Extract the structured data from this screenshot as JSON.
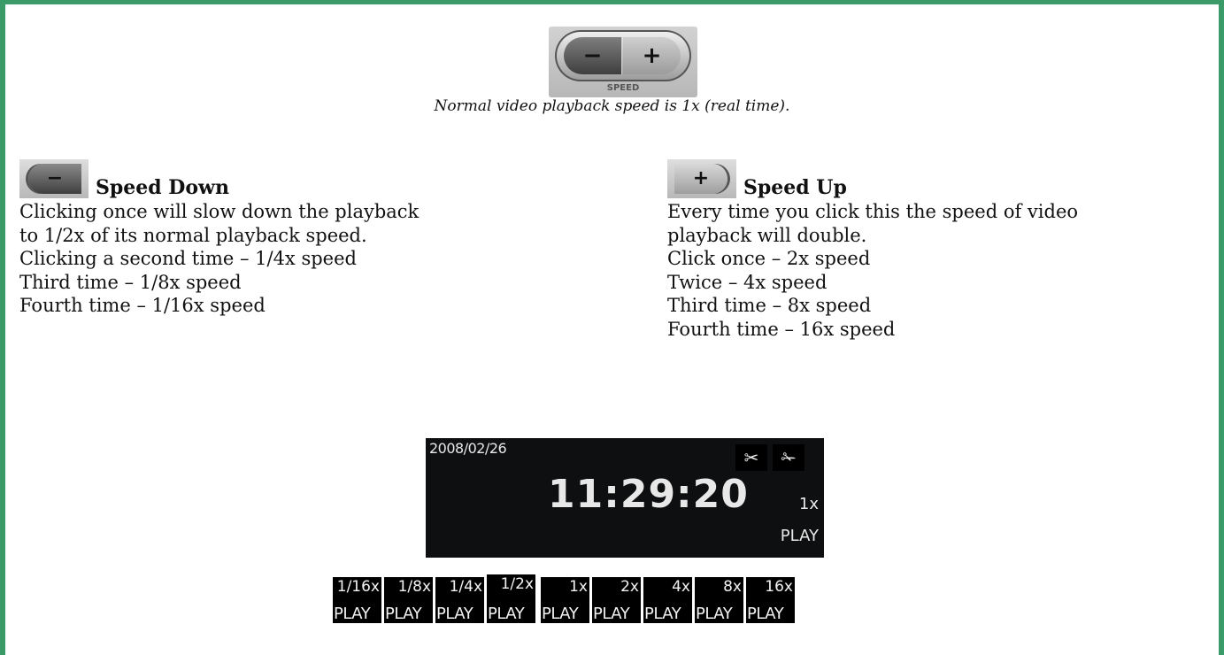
{
  "speed_control": {
    "minus_symbol": "−",
    "plus_symbol": "+",
    "caption": "SPEED"
  },
  "intro_text": "Normal video playback speed is 1x (real time).",
  "speed_down": {
    "icon": "minus-button-icon",
    "title": "Speed Down",
    "lines": [
      "Clicking once will slow down the playback",
      "to 1/2x of its normal playback speed.",
      "Clicking a second time – 1/4x speed",
      "Third time – 1/8x speed",
      "Fourth time – 1/16x speed"
    ]
  },
  "speed_up": {
    "icon": "plus-button-icon",
    "title": "Speed Up",
    "lines": [
      "Every time you click this the speed of video",
      "playback will double.",
      "Click once – 2x speed",
      "Twice – 4x speed",
      "Third time – 8x speed",
      "Fourth time – 16x speed"
    ]
  },
  "display": {
    "date": "2008/02/26",
    "time": "11:29:20",
    "speed": "1x",
    "mode": "PLAY",
    "icons": [
      "scissors-cut-start-icon",
      "scissors-cut-end-icon"
    ]
  },
  "speed_states": [
    {
      "speed": "1/16x",
      "mode": "PLAY"
    },
    {
      "speed": "1/8x",
      "mode": "PLAY"
    },
    {
      "speed": "1/4x",
      "mode": "PLAY"
    },
    {
      "speed": "1/2x",
      "mode": "PLAY"
    },
    {
      "speed": "1x",
      "mode": "PLAY"
    },
    {
      "speed": "2x",
      "mode": "PLAY"
    },
    {
      "speed": "4x",
      "mode": "PLAY"
    },
    {
      "speed": "8x",
      "mode": "PLAY"
    },
    {
      "speed": "16x",
      "mode": "PLAY"
    }
  ],
  "colors": {
    "frame_border": "#3a9a68",
    "display_bg": "#0e0f10"
  }
}
